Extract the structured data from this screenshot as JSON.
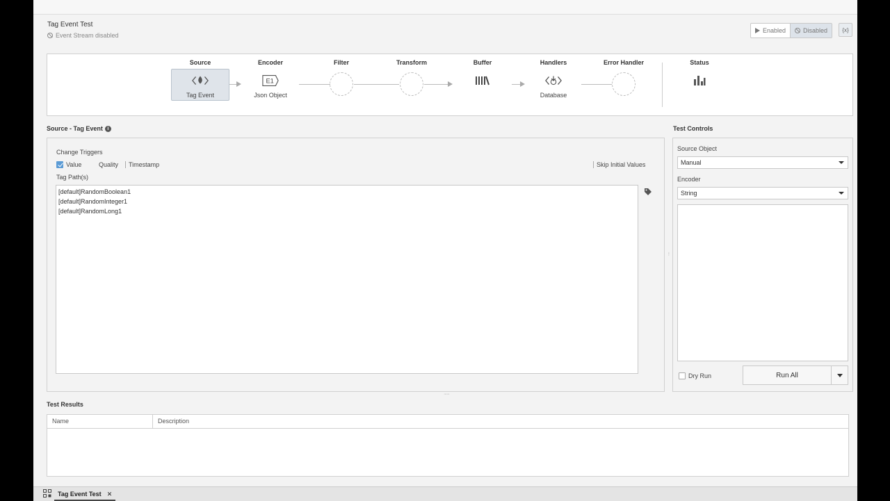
{
  "header": {
    "title": "Tag Event Test",
    "status_text": "Event Stream disabled",
    "enabled_label": "Enabled",
    "disabled_label": "Disabled",
    "code_label": "{x}"
  },
  "pipeline": {
    "stages": [
      {
        "label": "Source",
        "sub": "Tag Event",
        "icon": "tag-event-icon"
      },
      {
        "label": "Encoder",
        "sub": "Json Object",
        "icon": "encoder-icon"
      },
      {
        "label": "Filter",
        "sub": "",
        "icon": "empty-stage-icon"
      },
      {
        "label": "Transform",
        "sub": "",
        "icon": "empty-stage-icon"
      },
      {
        "label": "Buffer",
        "sub": "",
        "icon": "buffer-icon"
      },
      {
        "label": "Handlers",
        "sub": "Database",
        "icon": "database-handler-icon"
      },
      {
        "label": "Error Handler",
        "sub": "",
        "icon": "empty-stage-icon"
      },
      {
        "label": "Status",
        "sub": "",
        "icon": "bar-chart-icon"
      }
    ],
    "encoder_badge": "E1"
  },
  "source_section": {
    "title": "Source - Tag Event",
    "change_triggers_label": "Change Triggers",
    "triggers": [
      {
        "label": "Value",
        "checked": true
      },
      {
        "label": "Quality",
        "checked": false
      },
      {
        "label": "Timestamp",
        "checked": false
      }
    ],
    "skip_initial_label": "Skip Initial Values",
    "tag_paths_label": "Tag Path(s)",
    "tag_paths": [
      "[default]RandomBoolean1",
      "[default]RandomInteger1",
      "[default]RandomLong1"
    ]
  },
  "test_controls": {
    "title": "Test Controls",
    "source_object_label": "Source Object",
    "source_object_value": "Manual",
    "encoder_label": "Encoder",
    "encoder_value": "String",
    "dry_run_label": "Dry Run",
    "run_all_label": "Run All"
  },
  "test_results": {
    "title": "Test Results",
    "columns": [
      "Name",
      "Description"
    ]
  },
  "bottom_tab": {
    "label": "Tag Event Test",
    "close": "✕"
  },
  "colors": {
    "accent": "#5b9bd5",
    "selected_stage_bg": "#dfe4ea"
  }
}
